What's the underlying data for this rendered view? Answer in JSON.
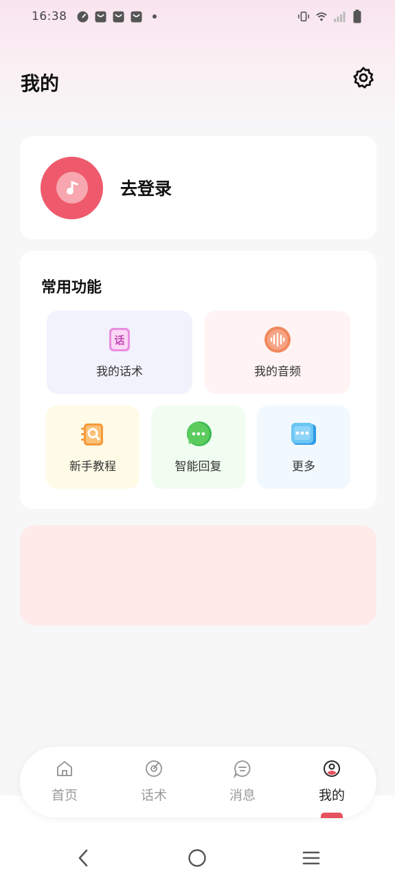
{
  "status_bar": {
    "time": "16:38",
    "left_icons": [
      "speedometer-icon",
      "shopping-bag-icon",
      "shopping-bag-icon",
      "shopping-bag-icon",
      "dot-icon"
    ],
    "right_icons": [
      "vibrate-icon",
      "wifi-icon",
      "signal-icon",
      "battery-icon"
    ]
  },
  "header": {
    "title": "我的",
    "settings_icon": "gear-icon"
  },
  "login_card": {
    "avatar_icon": "music-note-icon",
    "login_text": "去登录",
    "avatar_color": "#ee5a6c"
  },
  "functions": {
    "title": "常用功能",
    "items": [
      {
        "label": "我的话术",
        "icon": "script-icon",
        "icon_char": "话"
      },
      {
        "label": "我的音频",
        "icon": "audio-wave-icon"
      },
      {
        "label": "新手教程",
        "icon": "tutorial-book-icon"
      },
      {
        "label": "智能回复",
        "icon": "chat-bubble-icon"
      },
      {
        "label": "更多",
        "icon": "more-icon"
      }
    ]
  },
  "tabs": [
    {
      "label": "首页",
      "icon": "home-icon"
    },
    {
      "label": "话术",
      "icon": "script-tab-icon"
    },
    {
      "label": "消息",
      "icon": "message-icon"
    },
    {
      "label": "我的",
      "icon": "profile-icon",
      "active": true
    }
  ],
  "colors": {
    "accent": "#e5525e",
    "banner": "#ffeaea"
  }
}
